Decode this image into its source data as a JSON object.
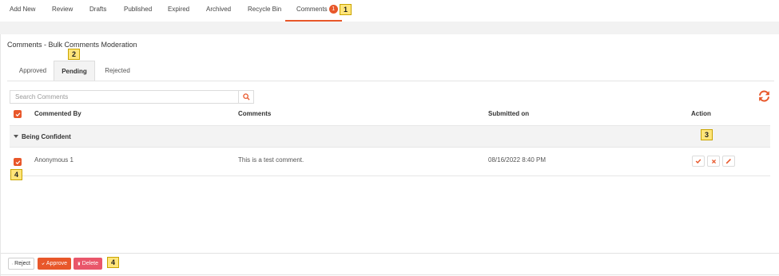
{
  "nav": {
    "items": [
      {
        "label": "Add New"
      },
      {
        "label": "Review"
      },
      {
        "label": "Drafts"
      },
      {
        "label": "Published"
      },
      {
        "label": "Expired"
      },
      {
        "label": "Archived"
      },
      {
        "label": "Recycle Bin"
      },
      {
        "label": "Comments",
        "badge": "1"
      }
    ]
  },
  "callouts": [
    "1",
    "2",
    "3",
    "4",
    "4"
  ],
  "page": {
    "title": "Comments - Bulk Comments Moderation"
  },
  "tabs": [
    {
      "label": "Approved"
    },
    {
      "label": "Pending"
    },
    {
      "label": "Rejected"
    }
  ],
  "search": {
    "placeholder": "Search Comments",
    "value": ""
  },
  "table": {
    "headers": {
      "commented_by": "Commented By",
      "comments": "Comments",
      "submitted_on": "Submitted on",
      "action": "Action"
    },
    "group": {
      "label": "Being Confident"
    },
    "rows": [
      {
        "commented_by": "Anonymous 1",
        "comment": "This is a test comment.",
        "submitted_on": "08/16/2022 8:40 PM"
      }
    ]
  },
  "footer": {
    "reject": "Reject",
    "approve": "Approve",
    "delete": "Delete"
  },
  "colors": {
    "accent": "#e8572a",
    "delete": "#e9566a",
    "callout": "#ffe57a"
  },
  "icons": {
    "search": "search-icon",
    "refresh": "refresh-icon",
    "approve": "check-icon",
    "reject": "close-icon",
    "edit": "pencil-icon",
    "delete": "trash-icon",
    "caret": "caret-down-icon"
  }
}
